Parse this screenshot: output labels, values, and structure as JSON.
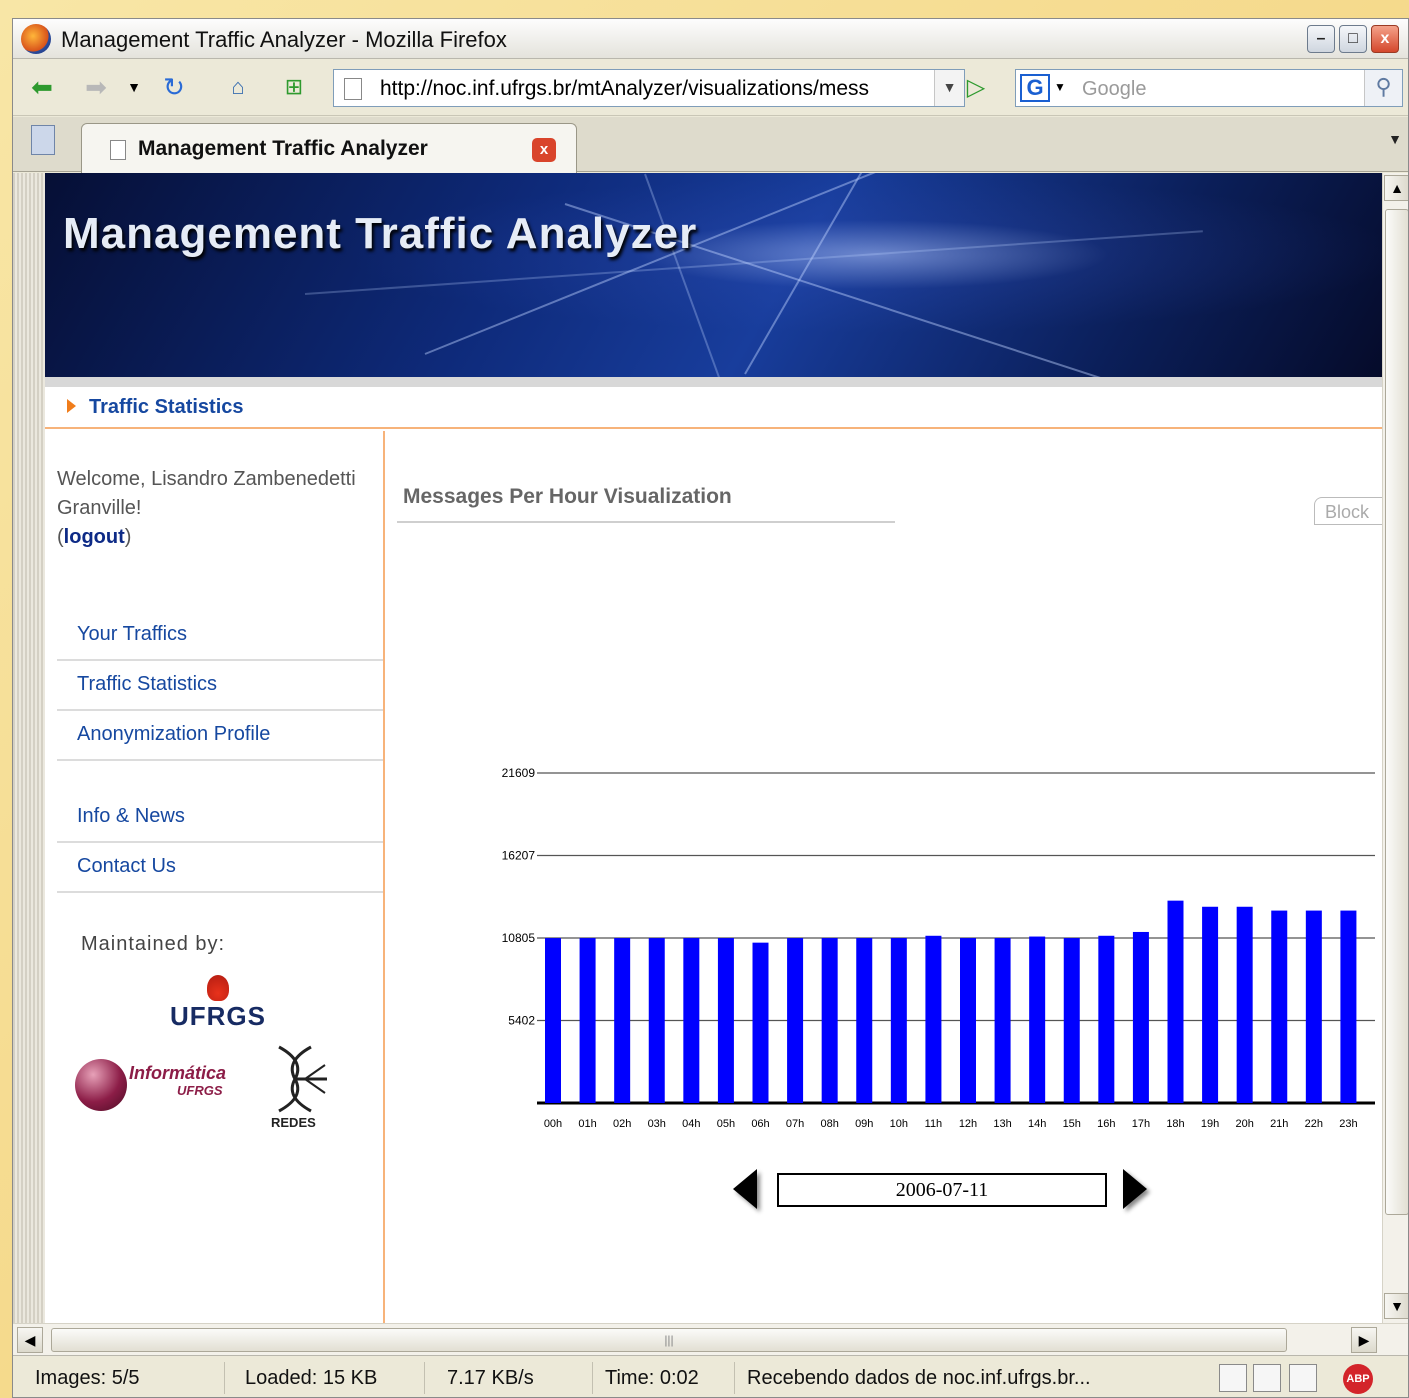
{
  "window": {
    "title": "Management Traffic Analyzer - Mozilla Firefox",
    "controls": {
      "minimize": "–",
      "maximize": "□",
      "close": "x"
    }
  },
  "toolbar": {
    "url": "http://noc.inf.ufrgs.br/mtAnalyzer/visualizations/mess",
    "search_placeholder": "Google",
    "search_engine_letter": "G"
  },
  "tab": {
    "title": "Management Traffic Analyzer",
    "close": "x"
  },
  "page": {
    "banner_title": "Management Traffic Analyzer",
    "breadcrumb": "Traffic Statistics",
    "welcome": {
      "prefix": "Welcome, ",
      "name": "Lisandro Zambenedetti Granville",
      "suffix": "!",
      "logout": "logout"
    },
    "nav_primary": [
      "Your Traffics",
      "Traffic Statistics",
      "Anonymization Profile"
    ],
    "nav_secondary": [
      "Info & News",
      "Contact Us"
    ],
    "maintained_by": "Maintained by:",
    "logos": {
      "ufrgs": "UFRGS",
      "informatica": "Informática",
      "informatica_sub": "UFRGS",
      "redes": "REDES"
    },
    "main_title": "Messages Per Hour Visualization",
    "block_tab": "Block",
    "date": "2006-07-11"
  },
  "chart_data": {
    "type": "bar",
    "categories": [
      "00h",
      "01h",
      "02h",
      "03h",
      "04h",
      "05h",
      "06h",
      "07h",
      "08h",
      "09h",
      "10h",
      "11h",
      "12h",
      "13h",
      "14h",
      "15h",
      "16h",
      "17h",
      "18h",
      "19h",
      "20h",
      "21h",
      "22h",
      "23h"
    ],
    "values": [
      10800,
      10800,
      10800,
      10800,
      10800,
      10800,
      10500,
      10800,
      10800,
      10800,
      10800,
      10950,
      10800,
      10800,
      10900,
      10800,
      10950,
      11200,
      13250,
      12850,
      12850,
      12600,
      12600,
      12600
    ],
    "yticks": [
      5402,
      10805,
      16207,
      21609
    ],
    "ylim": [
      0,
      21609
    ],
    "color": "#0000ff",
    "grid": true,
    "title": "",
    "xlabel": "",
    "ylabel": ""
  },
  "status": {
    "images": "Images: 5/5",
    "loaded": "Loaded: 15 KB",
    "speed": "7.17 KB/s",
    "time": "Time: 0:02",
    "message": "Recebendo dados de noc.inf.ufrgs.br...",
    "abp": "ABP"
  }
}
